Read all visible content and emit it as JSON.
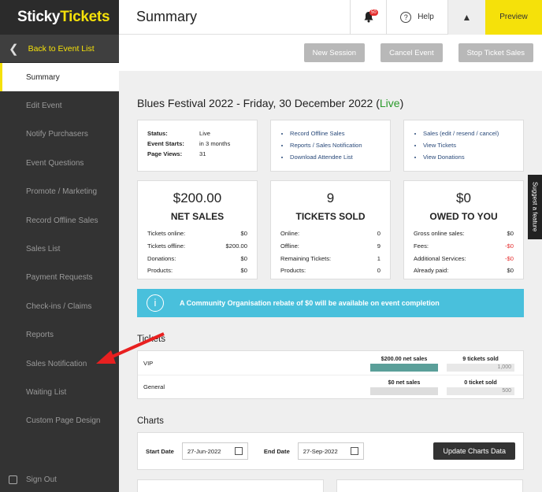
{
  "sidebar": {
    "logo_a": "Sticky",
    "logo_b": "Tickets",
    "back_label": "Back to Event List",
    "items": [
      "Summary",
      "Edit Event",
      "Notify Purchasers",
      "Event Questions",
      "Promote / Marketing",
      "Record Offline Sales",
      "Sales List",
      "Payment Requests",
      "Check-ins / Claims",
      "Reports",
      "Sales Notification",
      "Waiting List",
      "Custom Page Design"
    ],
    "signout": "Sign Out"
  },
  "topbar": {
    "title": "Summary",
    "bell_badge": "50",
    "help": "Help",
    "preview": "Preview"
  },
  "actions": [
    "New Session",
    "Cancel Event",
    "Stop Ticket Sales"
  ],
  "event": {
    "title": "Blues Festival 2022 - Friday, 30 December 2022 (",
    "live": "Live",
    "close": ")"
  },
  "info": {
    "rows": [
      [
        "Status:",
        "Live"
      ],
      [
        "Event Starts:",
        "in 3 months"
      ],
      [
        "Page Views:",
        "31"
      ]
    ]
  },
  "links1": [
    "Record Offline Sales",
    "Reports / Sales Notification",
    "Download Attendee List"
  ],
  "links2": [
    "Sales (edit / resend / cancel)",
    "View Tickets",
    "View Donations"
  ],
  "stats": [
    {
      "big": "$200.00",
      "label": "NET SALES",
      "rows": [
        [
          "Tickets online:",
          "$0"
        ],
        [
          "Tickets offline:",
          "$200.00"
        ],
        [
          "Donations:",
          "$0"
        ],
        [
          "Products:",
          "$0"
        ]
      ]
    },
    {
      "big": "9",
      "label": "TICKETS SOLD",
      "rows": [
        [
          "Online:",
          "0"
        ],
        [
          "Offline:",
          "9"
        ],
        [
          "Remaining Tickets:",
          "1"
        ],
        [
          "Products:",
          "0"
        ]
      ]
    },
    {
      "big": "$0",
      "label": "OWED TO YOU",
      "rows": [
        [
          "Gross online sales:",
          "$0"
        ],
        [
          "Fees:",
          "-$0"
        ],
        [
          "Additional Services:",
          "-$0"
        ],
        [
          "Already paid:",
          "$0"
        ]
      ]
    }
  ],
  "notice": "A Community Organisation rebate of $0 will be available on event completion",
  "tickets": {
    "heading": "Tickets",
    "rows": [
      {
        "name": "VIP",
        "sales": "$200.00 net sales",
        "sold": "9 tickets sold",
        "cap": "1,000",
        "fill": 1
      },
      {
        "name": "General",
        "sales": "$0 net sales",
        "sold": "0 ticket sold",
        "cap": "500",
        "fill": 0
      }
    ]
  },
  "charts": {
    "heading": "Charts",
    "start_label": "Start Date",
    "start": "27-Jun-2022",
    "end_label": "End Date",
    "end": "27-Sep-2022",
    "button": "Update Charts Data"
  },
  "suggest": "Suggest a feature",
  "colors": {
    "accent": "#f5e10a",
    "sidebar": "#333333",
    "live": "#2a9a2a",
    "notice": "#49c0dc",
    "negative": "#e53030"
  }
}
